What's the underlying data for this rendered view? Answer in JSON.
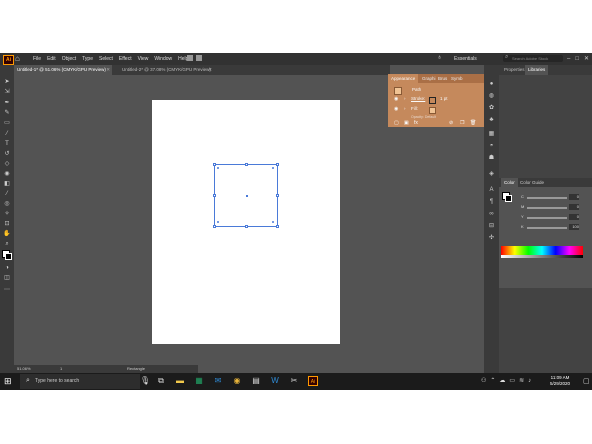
{
  "menubar": {
    "app_logo": "Ai",
    "items": [
      "File",
      "Edit",
      "Object",
      "Type",
      "Select",
      "Effect",
      "View",
      "Window",
      "Help"
    ],
    "workspace": "Essentials",
    "search_placeholder": "Search Adobe Stock"
  },
  "tabs": [
    {
      "label": "Untitled-1* @ 51.06% (CMYK/GPU Preview)",
      "active": true
    },
    {
      "label": "Untitled-2* @ 37.08% (CMYK/GPU Preview)",
      "active": false
    }
  ],
  "appearance_panel": {
    "tabs": [
      "Appearance",
      "Graphi",
      "Brus",
      "Symb"
    ],
    "object_type": "Path",
    "stroke_label": "Stroke:",
    "stroke_weight": "1 pt",
    "fill_label": "Fill:",
    "opacity_label": "Opacity:",
    "opacity_value": "Default",
    "highlight_color": "#c98b5d"
  },
  "right_panel": {
    "tabs": [
      "Properties",
      "Libraries"
    ]
  },
  "color_panel": {
    "tabs": [
      "Color",
      "Color Guide"
    ],
    "channels": [
      {
        "label": "C",
        "value": "0"
      },
      {
        "label": "M",
        "value": "0"
      },
      {
        "label": "Y",
        "value": "0"
      },
      {
        "label": "K",
        "value": "100"
      }
    ]
  },
  "statusbar": {
    "zoom": "51.06%",
    "artboard": "1",
    "tool": "Rectangle"
  },
  "taskbar": {
    "search_placeholder": "Type here to search",
    "time": "11:09 AM",
    "date": "5/29/2020"
  }
}
